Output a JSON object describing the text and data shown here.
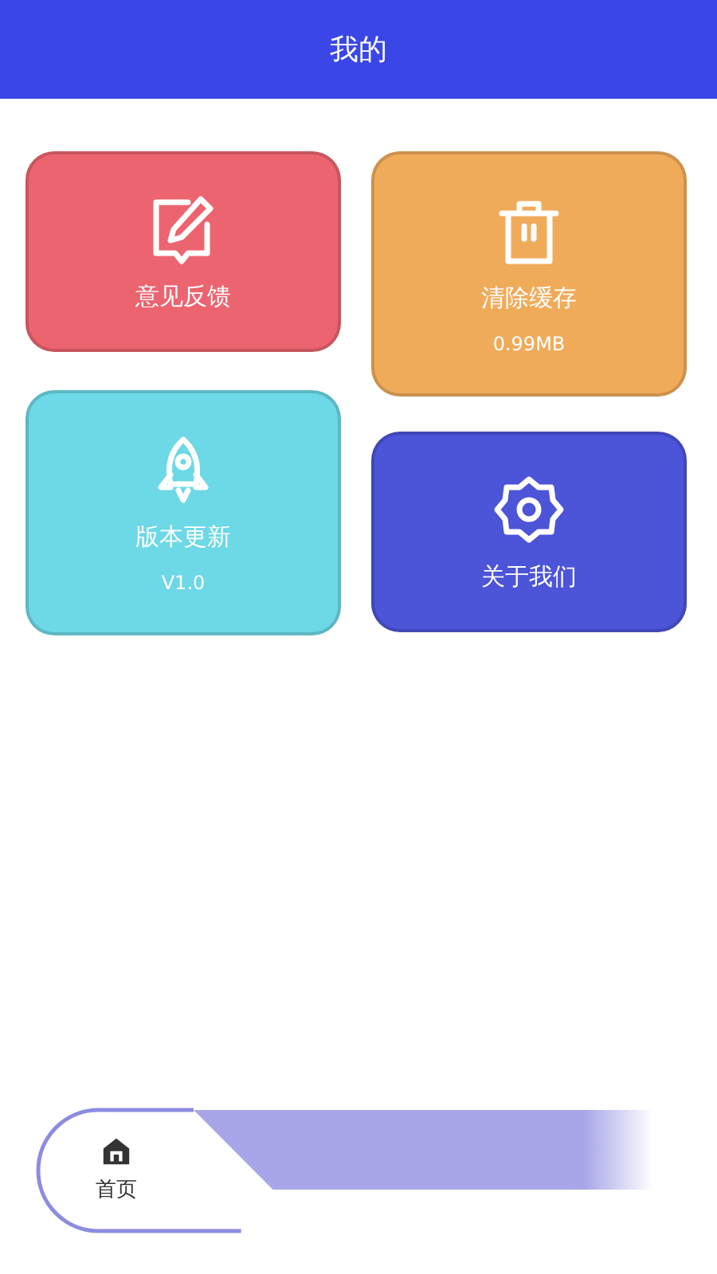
{
  "header": {
    "title": "我的"
  },
  "tiles": [
    {
      "kind": "feedback",
      "label": "意见反馈",
      "color": "#ec6470"
    },
    {
      "kind": "trash",
      "label": "清除缓存",
      "detail": "0.99MB",
      "color": "#f0ab5a"
    },
    {
      "kind": "rocket",
      "label": "版本更新",
      "detail": "V1.0",
      "color": "#6dd8e6"
    },
    {
      "kind": "gear",
      "label": "关于我们",
      "color": "#4c54d8"
    }
  ],
  "tab_bar": {
    "items": [
      {
        "label": "首页",
        "selected": true
      }
    ]
  }
}
